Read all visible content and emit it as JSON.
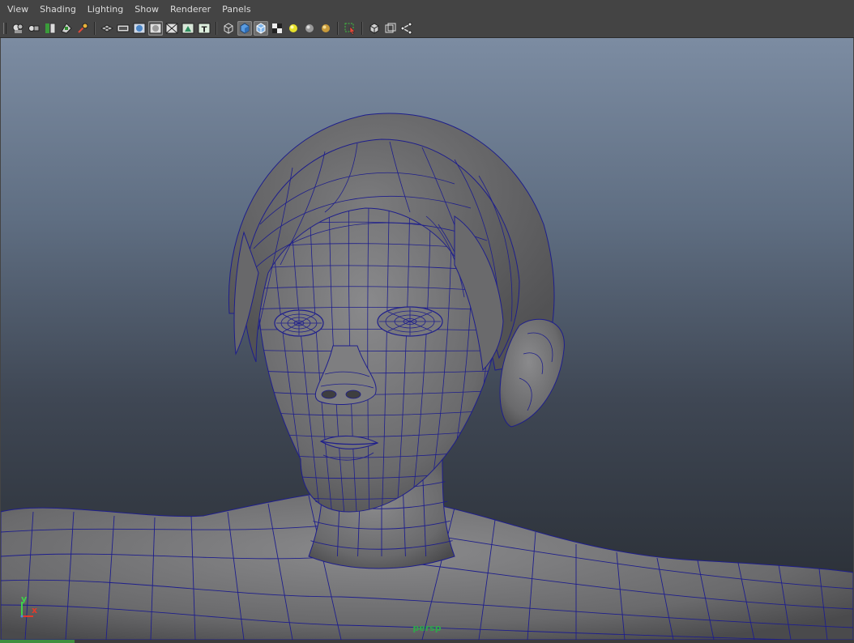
{
  "menu": {
    "items": [
      "View",
      "Shading",
      "Lighting",
      "Show",
      "Renderer",
      "Panels"
    ]
  },
  "toolbar": {
    "groups": [
      [
        "select-camera-icon",
        "lock-camera-icon",
        "bookmark-icon",
        "image-plane-icon",
        "2d-pan-zoom-icon"
      ],
      [
        "grid-icon",
        "film-gate-icon",
        "resolution-gate-icon",
        "gate-mask-icon",
        "field-chart-icon",
        "safe-action-icon",
        "safe-title-icon"
      ],
      [
        "wireframe-icon",
        "smooth-shade-icon",
        "wireframe-on-shaded-icon",
        "textured-icon",
        "use-all-lights-icon",
        "shadows-icon",
        "ambient-occlusion-icon"
      ],
      [
        "isolate-select-icon"
      ],
      [
        "xray-icon",
        "xray-active-components-icon",
        "xray-joints-icon"
      ]
    ],
    "active": [
      "smooth-shade-icon",
      "wireframe-on-shaded-icon"
    ]
  },
  "viewport": {
    "camera_label": "persp",
    "axis_x": "x",
    "axis_y": "y",
    "colors": {
      "sky_top": "#7c8ca2",
      "sky_bottom": "#262a30",
      "mesh": "#6e6e70",
      "wire": "#1e1e8c",
      "camera_label": "#2ea84a",
      "axis_x": "#e23a2a",
      "axis_y": "#3fd34a"
    }
  }
}
